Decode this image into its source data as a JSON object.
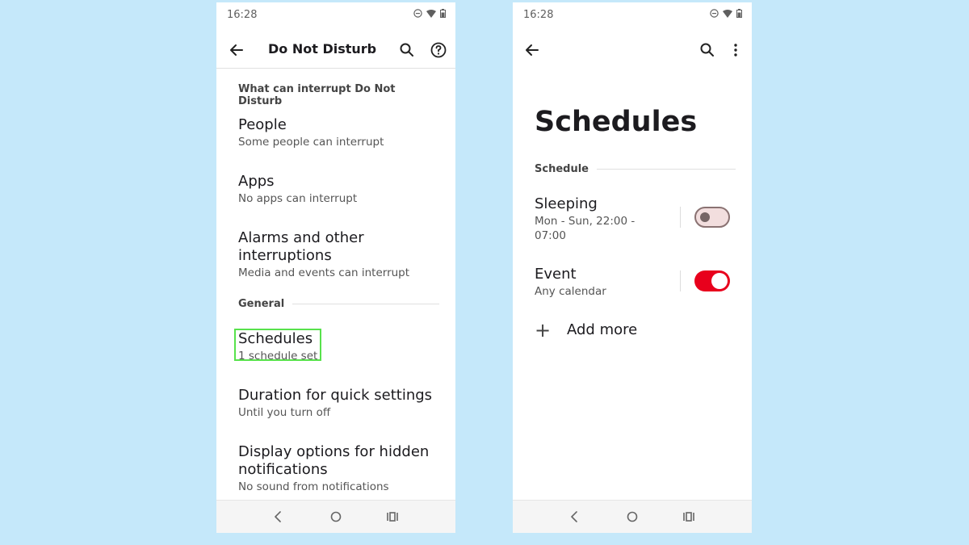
{
  "left_screen": {
    "status_time": "16:28",
    "title": "Do Not Disturb",
    "section_interrupt": "What can interrupt Do Not Disturb",
    "items": [
      {
        "title": "People",
        "summary": "Some people can interrupt"
      },
      {
        "title": "Apps",
        "summary": "No apps can interrupt"
      },
      {
        "title": "Alarms and other interruptions",
        "summary": "Media and events can interrupt"
      }
    ],
    "section_general": "General",
    "general_items": [
      {
        "title": "Schedules",
        "summary": "1 schedule set"
      },
      {
        "title": "Duration for quick settings",
        "summary": "Until you turn off"
      },
      {
        "title": "Display options for hidden notifications",
        "summary": "No sound from notifications"
      }
    ]
  },
  "right_screen": {
    "status_time": "16:28",
    "large_title": "Schedules",
    "section_schedule": "Schedule",
    "schedules": [
      {
        "title": "Sleeping",
        "summary": "Mon - Sun, 22:00 - 07:00",
        "enabled": false
      },
      {
        "title": "Event",
        "summary": "Any calendar",
        "enabled": true
      }
    ],
    "add_more_label": "Add more"
  },
  "icons": {
    "back": "arrow-back-icon",
    "search": "search-icon",
    "help": "help-circle-icon",
    "more": "more-vert-icon",
    "dnd": "do-not-disturb-icon",
    "wifi": "wifi-icon",
    "battery": "battery-icon",
    "nav_back": "nav-back-icon",
    "nav_home": "nav-home-icon",
    "nav_recents": "nav-recents-icon",
    "plus": "plus-icon"
  },
  "colors": {
    "background": "#c5e8fa",
    "toggle_on": "#e8001c",
    "highlight": "#58e24c"
  }
}
